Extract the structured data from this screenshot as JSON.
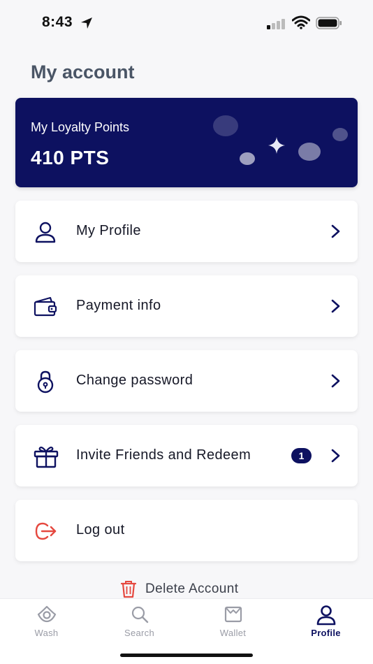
{
  "status_bar": {
    "time": "8:43"
  },
  "page": {
    "title": "My account"
  },
  "loyalty": {
    "label": "My Loyalty Points",
    "points": "410 PTS"
  },
  "menu": [
    {
      "label": "My Profile",
      "icon": "user-icon"
    },
    {
      "label": "Payment info",
      "icon": "wallet-icon"
    },
    {
      "label": "Change password",
      "icon": "lock-icon"
    },
    {
      "label": "Invite Friends and Redeem",
      "icon": "gift-icon",
      "badge": "1"
    },
    {
      "label": "Log out",
      "icon": "logout-icon"
    }
  ],
  "delete_account": {
    "label": "Delete Account",
    "icon": "trash-icon"
  },
  "tabs": [
    {
      "label": "Wash",
      "icon": "wash-icon"
    },
    {
      "label": "Search",
      "icon": "search-icon"
    },
    {
      "label": "Wallet",
      "icon": "wallet-tab-icon"
    },
    {
      "label": "Profile",
      "icon": "profile-icon",
      "active": true
    }
  ],
  "colors": {
    "brand": "#0d1160",
    "logout": "#e5483f",
    "delete": "#e5483f",
    "tab_inactive": "#9a9ca6",
    "title": "#4a5566"
  }
}
